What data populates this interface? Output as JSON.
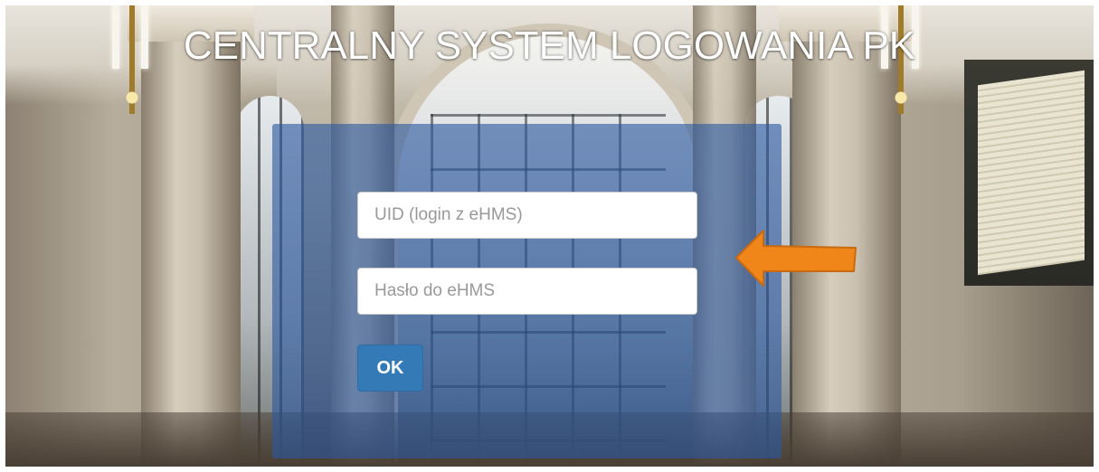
{
  "title": "CENTRALNY SYSTEM LOGOWANIA PK",
  "login": {
    "uid_placeholder": "UID (login z eHMS)",
    "uid_value": "",
    "password_placeholder": "Hasło do eHMS",
    "password_value": "",
    "ok_label": "OK"
  },
  "colors": {
    "panel": "#2c58a0",
    "button": "#337ab7",
    "arrow": "#f08519",
    "arrow_outline": "#c96a10",
    "title_text": "#ffffff"
  },
  "icons": {
    "pointer": "arrow-left-icon"
  }
}
